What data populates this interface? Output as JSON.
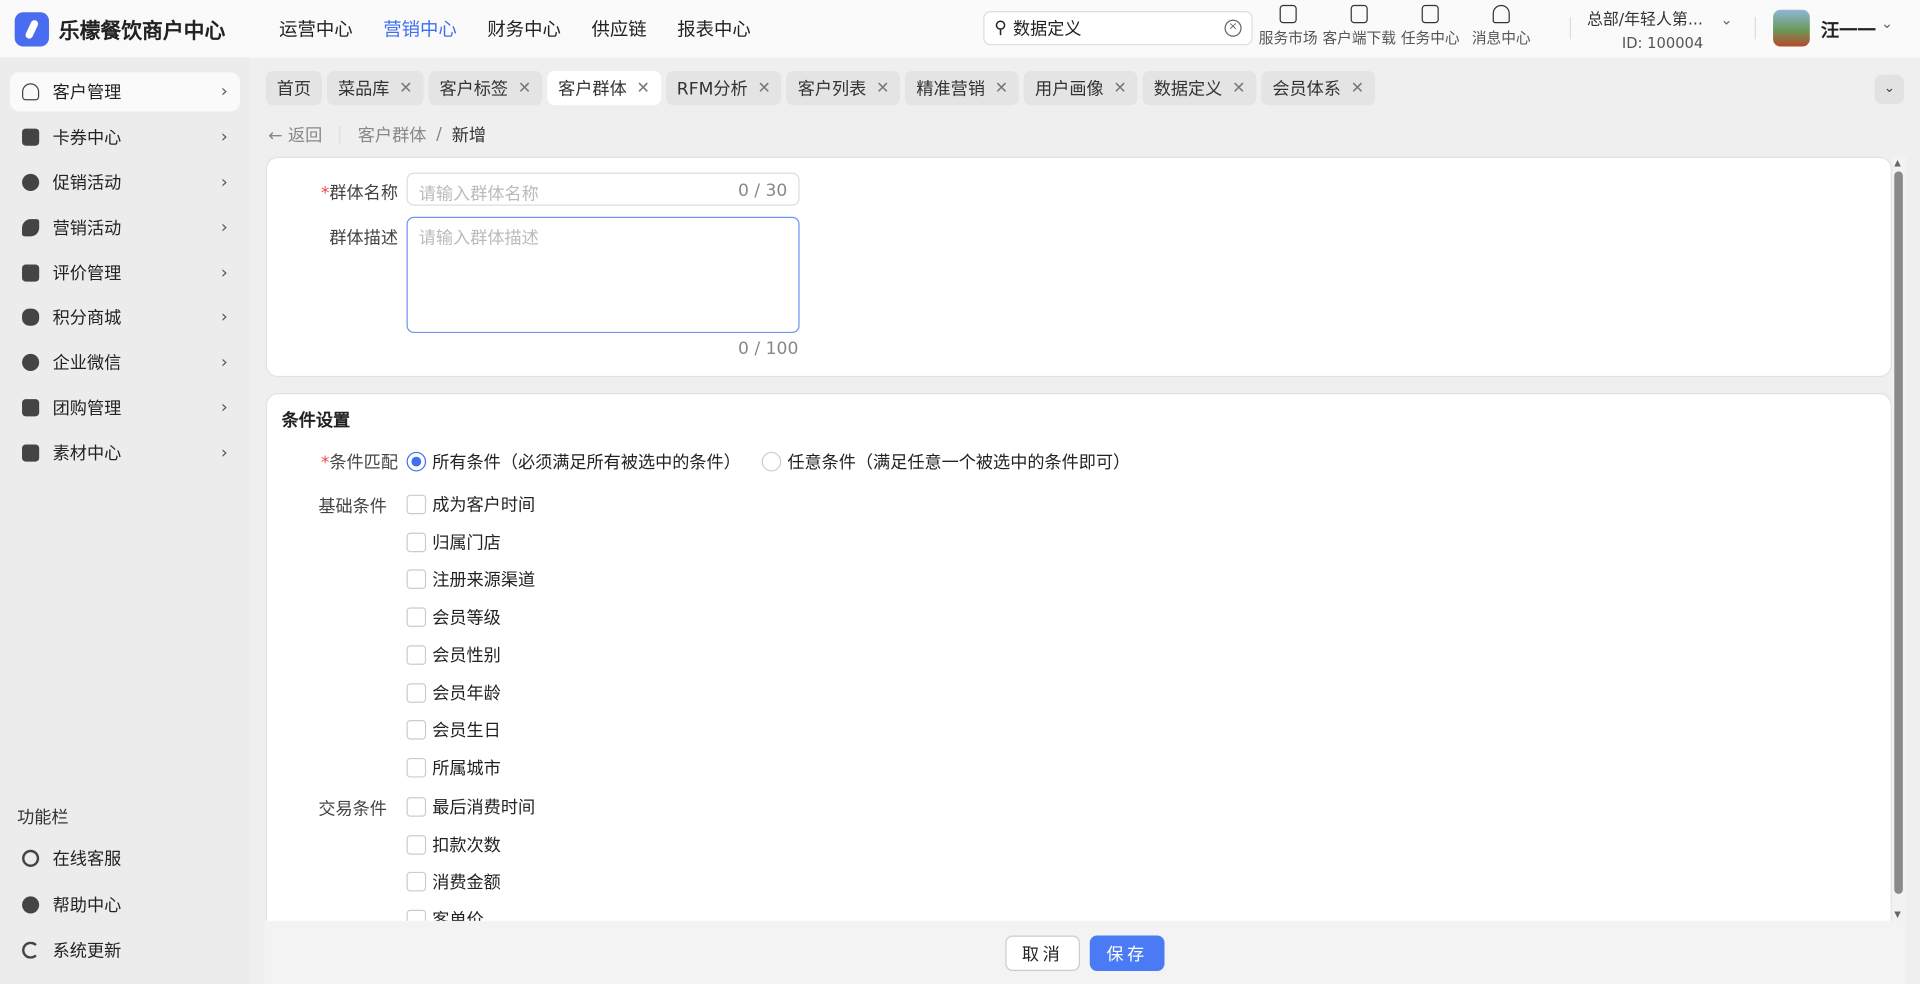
{
  "app": {
    "title": "乐檬餐饮商户中心"
  },
  "topnav": [
    "运营中心",
    "营销中心",
    "财务中心",
    "供应链",
    "报表中心"
  ],
  "topnav_active": 1,
  "search": {
    "value": "数据定义"
  },
  "tools": [
    "服务市场",
    "客户端下载",
    "任务中心",
    "消息中心"
  ],
  "org": {
    "name": "总部/年轻人第...",
    "id": "ID: 100004"
  },
  "user": {
    "name": "汪一一"
  },
  "sidebar": {
    "items": [
      {
        "label": "客户管理",
        "icon": "user-icon"
      },
      {
        "label": "卡券中心",
        "icon": "ticket-icon"
      },
      {
        "label": "促销活动",
        "icon": "discount-badge-icon"
      },
      {
        "label": "营销活动",
        "icon": "tag-icon"
      },
      {
        "label": "评价管理",
        "icon": "edit-review-icon"
      },
      {
        "label": "积分商城",
        "icon": "coins-stack-icon"
      },
      {
        "label": "企业微信",
        "icon": "chat-bubble-icon"
      },
      {
        "label": "团购管理",
        "icon": "store-icon"
      },
      {
        "label": "素材中心",
        "icon": "image-icon"
      }
    ],
    "func_title": "功能栏",
    "func_items": [
      {
        "label": "在线客服",
        "icon": "headset-icon"
      },
      {
        "label": "帮助中心",
        "icon": "help-icon"
      },
      {
        "label": "系统更新",
        "icon": "refresh-icon"
      }
    ]
  },
  "tabs": [
    {
      "label": "首页",
      "closable": false
    },
    {
      "label": "菜品库"
    },
    {
      "label": "客户标签"
    },
    {
      "label": "客户群体",
      "active": true
    },
    {
      "label": "RFM分析"
    },
    {
      "label": "客户列表"
    },
    {
      "label": "精准营销"
    },
    {
      "label": "用户画像"
    },
    {
      "label": "数据定义"
    },
    {
      "label": "会员体系"
    }
  ],
  "breadcrumb": {
    "back": "返回",
    "parent": "客户群体",
    "sep": "/",
    "current": "新增"
  },
  "form": {
    "name_label": "群体名称",
    "name_placeholder": "请输入群体名称",
    "name_count": "0 / 30",
    "desc_label": "群体描述",
    "desc_placeholder": "请输入群体描述",
    "desc_count": "0 / 100"
  },
  "conditions": {
    "title": "条件设置",
    "match_label": "条件匹配",
    "match_options": [
      "所有条件（必须满足所有被选中的条件）",
      "任意条件（满足任意一个被选中的条件即可）"
    ],
    "match_selected": 0,
    "basic_label": "基础条件",
    "basic": [
      "成为客户时间",
      "归属门店",
      "注册来源渠道",
      "会员等级",
      "会员性别",
      "会员年龄",
      "会员生日",
      "所属城市"
    ],
    "trade_label": "交易条件",
    "trade": [
      "最后消费时间",
      "扣款次数",
      "消费金额",
      "客单价"
    ]
  },
  "footer": {
    "cancel": "取消",
    "save": "保存"
  },
  "colors": {
    "accent": "#3f6ff0",
    "save": "#4a7bf5",
    "required": "#f04a4a"
  }
}
